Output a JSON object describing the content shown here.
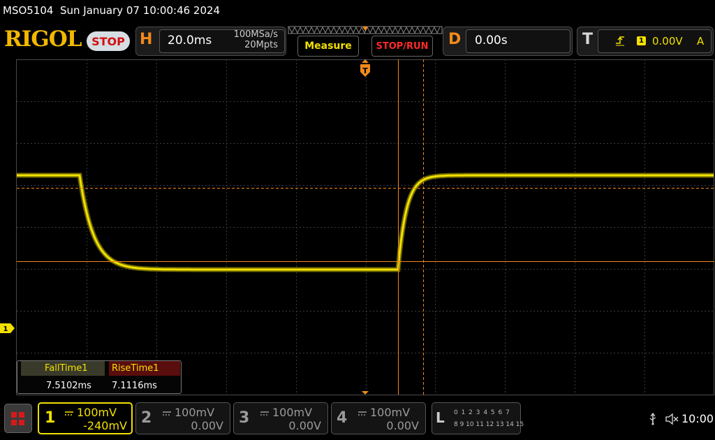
{
  "status_bar": {
    "model": "MSO5104",
    "datetime": "Sun January 07 10:00:46 2024",
    "brand": "RIGOL",
    "run_state": "STOP"
  },
  "horizontal": {
    "letter": "H",
    "timebase": "20.0ms",
    "sample_rate": "100MSa/s",
    "memory_depth": "20Mpts"
  },
  "buttons": {
    "measure": "Measure",
    "stop_run": "STOP/RUN"
  },
  "delay": {
    "letter": "D",
    "value": "0.00s"
  },
  "trigger": {
    "letter": "T",
    "channel": "1",
    "level": "0.00V",
    "source": "A"
  },
  "markers": {
    "trigger_position": "T",
    "channel1_ground": "1"
  },
  "measurements": [
    {
      "name": "FallTime1",
      "value": "7.5102ms"
    },
    {
      "name": "RiseTime1",
      "value": "7.1116ms"
    }
  ],
  "channels": [
    {
      "number": "1",
      "scale": "100mV",
      "offset": "-240mV",
      "color": "#f2e000",
      "active": true
    },
    {
      "number": "2",
      "scale": "100mV",
      "offset": "0.00V",
      "color": "#9a9a9a",
      "active": false
    },
    {
      "number": "3",
      "scale": "100mV",
      "offset": "0.00V",
      "color": "#9a9a9a",
      "active": false
    },
    {
      "number": "4",
      "scale": "100mV",
      "offset": "0.00V",
      "color": "#9a9a9a",
      "active": false
    }
  ],
  "logic_analyzer": {
    "letter": "L",
    "row1": "0 1 2 3  4 5 6 7",
    "row2": "8 9 10 11 12 13 14 15"
  },
  "system": {
    "time": "10:00"
  },
  "colors": {
    "trace": "#f2e000",
    "cursor": "#f2861a",
    "grid": "#3c3c3c",
    "brand": "#f2b800"
  }
}
